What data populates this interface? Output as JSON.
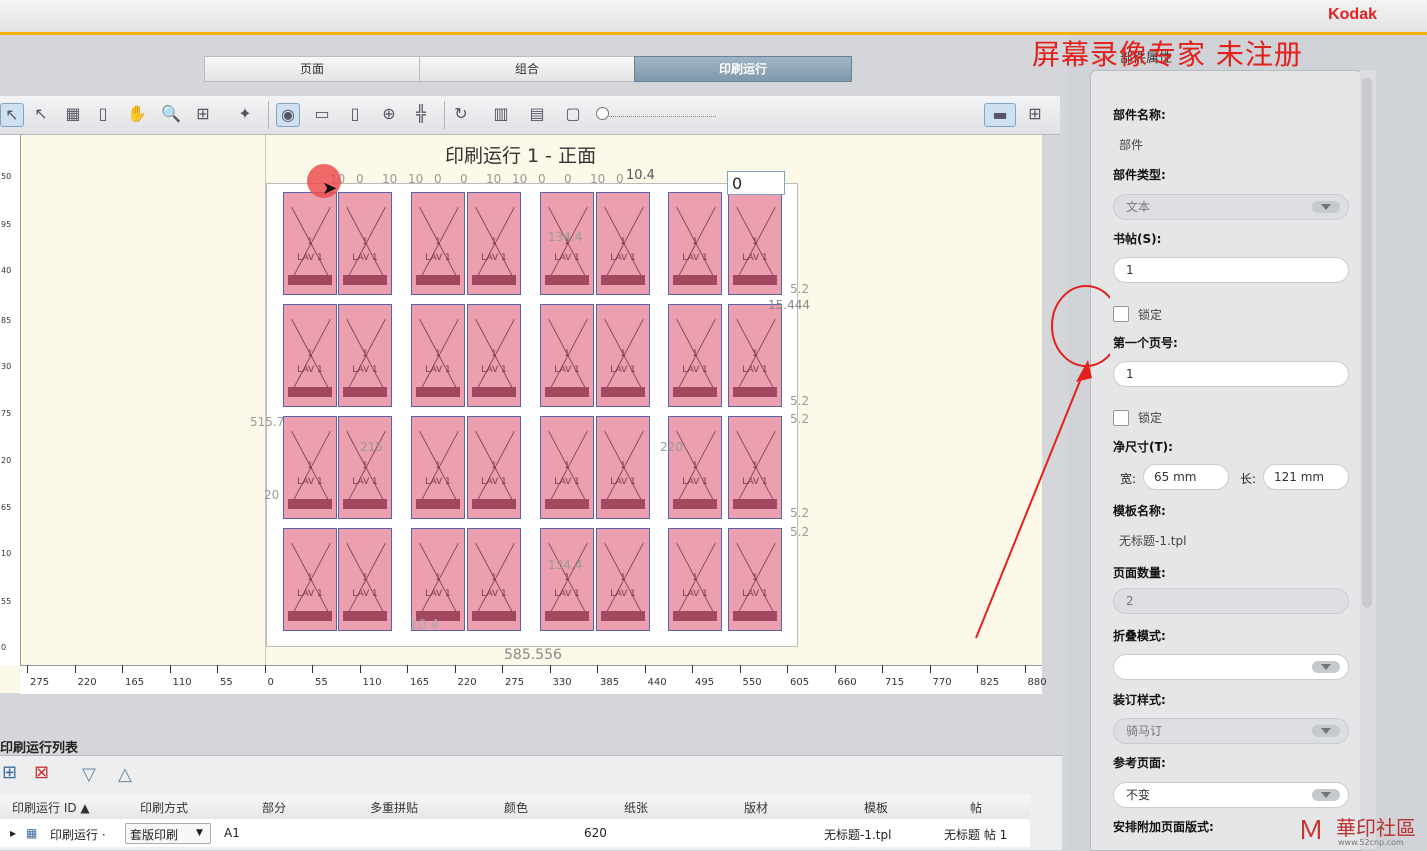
{
  "brand": "Kodak",
  "watermark": "屏幕录像专家 未注册",
  "tabs": [
    {
      "label": "页面"
    },
    {
      "label": "组合"
    },
    {
      "label": "印刷运行"
    }
  ],
  "canvas": {
    "title": "印刷运行 1 - 正面",
    "input_value": "0",
    "hruler": [
      "275",
      "220",
      "165",
      "110",
      "55",
      "0",
      "55",
      "110",
      "165",
      "220",
      "275",
      "330",
      "385",
      "440",
      "495",
      "550",
      "605",
      "660",
      "715",
      "770",
      "825",
      "880"
    ],
    "vruler": [
      "50",
      "95",
      "40",
      "85",
      "30",
      "75",
      "20",
      "65",
      "10",
      "55",
      "0"
    ],
    "dims": {
      "bottom": "585.556",
      "top_gap": "10.4",
      "top_gap_b": "10.4",
      "left_h": "515.7",
      "left_w": "20",
      "side1": "5.2",
      "side2": "5.2",
      "side3": "5.2",
      "side4": "5.2",
      "side5": "5.2",
      "side6": "5.2",
      "cut": "15.444",
      "mid": "215",
      "mid2": "220",
      "span": "134.4",
      "span2": "134.4",
      "tops": [
        "10",
        "0",
        "10",
        "10",
        "0",
        "0",
        "10",
        "10",
        "0",
        "0",
        "10",
        "0"
      ]
    },
    "page_mark": "LAV 1",
    "page_num": "1"
  },
  "list": {
    "title": "印刷运行列表",
    "columns": [
      "印刷运行 ID ▲",
      "印刷方式",
      "部分",
      "多重拼贴",
      "颜色",
      "纸张",
      "版材",
      "模板",
      "帖"
    ],
    "row": {
      "id": "印刷运行 ·",
      "method": "套版印刷",
      "part": "A1",
      "paper": "620",
      "template": "无标题-1.tpl",
      "signature": "无标题 帖 1"
    }
  },
  "props": {
    "header": "部件属性",
    "part_name_label": "部件名称:",
    "part_name": "部件",
    "part_type_label": "部件类型:",
    "part_type": "文本",
    "signature_label": "书帖(S):",
    "signature": "1",
    "lock1": "锁定",
    "first_page_label": "第一个页号:",
    "first_page": "1",
    "lock2": "锁定",
    "trim_label": "净尺寸(T):",
    "width_label": "宽:",
    "width": "65 mm",
    "length_label": "长:",
    "length": "121 mm",
    "template_label": "模板名称:",
    "template": "无标题-1.tpl",
    "page_count_label": "页面数量:",
    "page_count": "2",
    "fold_label": "折叠模式:",
    "fold": "",
    "binding_label": "装订样式:",
    "binding": "骑马订",
    "ref_label": "参考页面:",
    "ref": "不变",
    "extra_label": "安排附加页面版式:"
  },
  "logo": {
    "name": "華印社區",
    "url_text": "www.52cnp.com"
  },
  "colors": {
    "accent": "#f0b400",
    "page_fill": "#ec9fae",
    "active_tab": "#8aa3b6",
    "annotation": "#e2211c"
  }
}
